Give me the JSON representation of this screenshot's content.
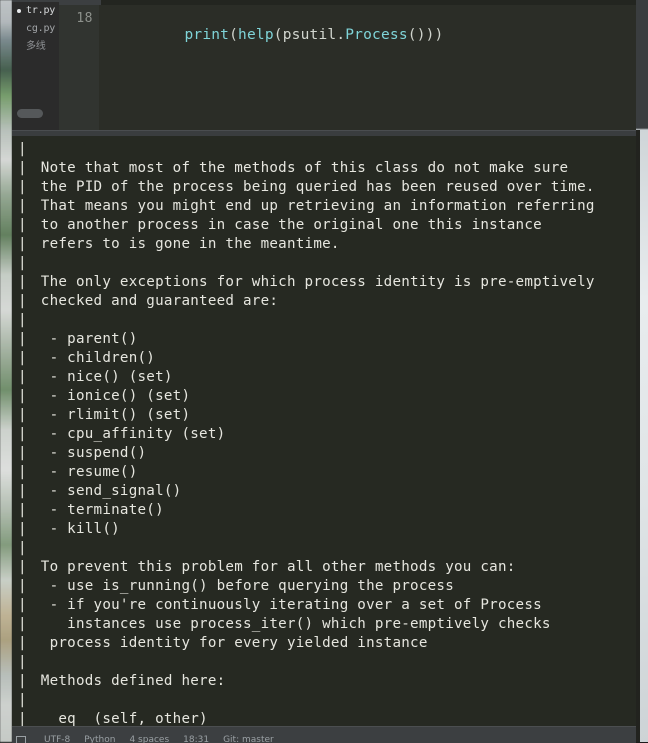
{
  "window": {
    "theme_bg": "#262922",
    "editor_bg": "#2b2d27",
    "sidebar_bg": "#2b2b2b",
    "accent": "#7fd4d8",
    "text": "#e6e6df"
  },
  "sidebar": {
    "files": [
      {
        "name": "tr.py",
        "active": true,
        "modified": true
      },
      {
        "name": "cg.py",
        "active": false,
        "modified": false
      },
      {
        "name": "多线",
        "active": false,
        "modified": false
      }
    ]
  },
  "editor": {
    "line_number": "18",
    "code_tokens": [
      {
        "text": "print",
        "type": "fn"
      },
      {
        "text": "(",
        "type": "pun"
      },
      {
        "text": "help",
        "type": "fn"
      },
      {
        "text": "(",
        "type": "pun"
      },
      {
        "text": "psutil",
        "type": "mod"
      },
      {
        "text": ".",
        "type": "pun"
      },
      {
        "text": "Process",
        "type": "cls"
      },
      {
        "text": "()))",
        "type": "pun"
      }
    ],
    "code_plain": "print(help(psutil.Process()))"
  },
  "terminal": {
    "gutter_char": "|",
    "lines": [
      "",
      " Note that most of the methods of this class do not make sure",
      " the PID of the process being queried has been reused over time.",
      " That means you might end up retrieving an information referring",
      " to another process in case the original one this instance",
      " refers to is gone in the meantime.",
      "",
      " The only exceptions for which process identity is pre-emptively",
      " checked and guaranteed are:",
      "",
      "  - parent()",
      "  - children()",
      "  - nice() (set)",
      "  - ionice() (set)",
      "  - rlimit() (set)",
      "  - cpu_affinity (set)",
      "  - suspend()",
      "  - resume()",
      "  - send_signal()",
      "  - terminate()",
      "  - kill()",
      "",
      " To prevent this problem for all other methods you can:",
      "  - use is_running() before querying the process",
      "  - if you're continuously iterating over a set of Process",
      "    instances use process_iter() which pre-emptively checks",
      "  process identity for every yielded instance",
      "",
      " Methods defined here:",
      "",
      " __eq__(self, other)"
    ]
  },
  "statusbar": {
    "items": [
      "UTF-8",
      "Python",
      "4 spaces",
      "18:31",
      "Git: master"
    ]
  }
}
